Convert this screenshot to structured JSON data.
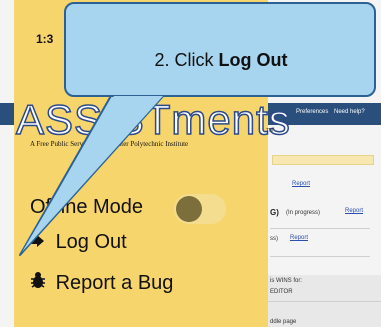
{
  "status_bar": {
    "time": "1:3"
  },
  "background_page": {
    "nav": {
      "preferences": "Preferences",
      "help": "Need help?"
    },
    "links": [
      "Report",
      "Report",
      "Report"
    ],
    "assignment_code": "G)",
    "assignment_status": "(In progress)",
    "partial_text": "ss)",
    "wins_heading": "is WINS for:",
    "editor": "EDITOR",
    "more": "ddle page"
  },
  "menu": {
    "logo": "ASSISTments",
    "trademark": "TM",
    "tagline": "A Free Public Service of Worcester Polytechnic Institute",
    "offline_mode_label": "Offline Mode",
    "offline_mode_on": false,
    "log_out_label": "Log Out",
    "report_bug_label": "Report a Bug",
    "icons": {
      "log_out": "sign-out-icon",
      "report_bug": "bug-icon"
    }
  },
  "callout": {
    "prefix": "2. Click ",
    "action": "Log Out"
  },
  "colors": {
    "menu_bg": "#f7d56d",
    "callout_bg": "#a7d4ef",
    "callout_border": "#2b6293",
    "nav_bar": "#2a4f7d"
  }
}
